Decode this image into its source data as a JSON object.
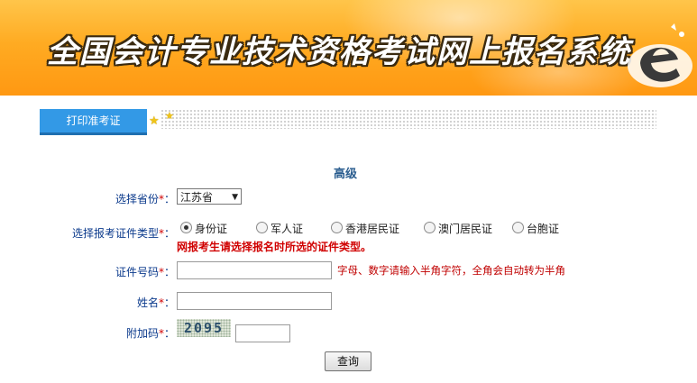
{
  "banner": {
    "title": "全国会计专业技术资格考试网上报名系统"
  },
  "tabs": {
    "print_admission": "打印准考证"
  },
  "form": {
    "level": "高级",
    "province_label": "选择省份",
    "province_value": "江苏省",
    "id_type_label": "选择报考证件类型",
    "id_types": [
      "身份证",
      "军人证",
      "香港居民证",
      "澳门居民证",
      "台胞证"
    ],
    "id_type_selected": "身份证",
    "id_type_warning": "网报考生请选择报名时所选的证件类型。",
    "id_number_label": "证件号码",
    "id_number_hint": "字母、数字请输入半角字符，全角会自动转为半角",
    "name_label": "姓名",
    "captcha_label": "附加码",
    "captcha_code": "2095",
    "required_mark": "*",
    "label_suffix": "：",
    "query_button": "查询"
  },
  "colors": {
    "tab": "#3399e6",
    "label": "#0b3a8c",
    "warning": "#d00000",
    "banner": "#ffab22"
  }
}
